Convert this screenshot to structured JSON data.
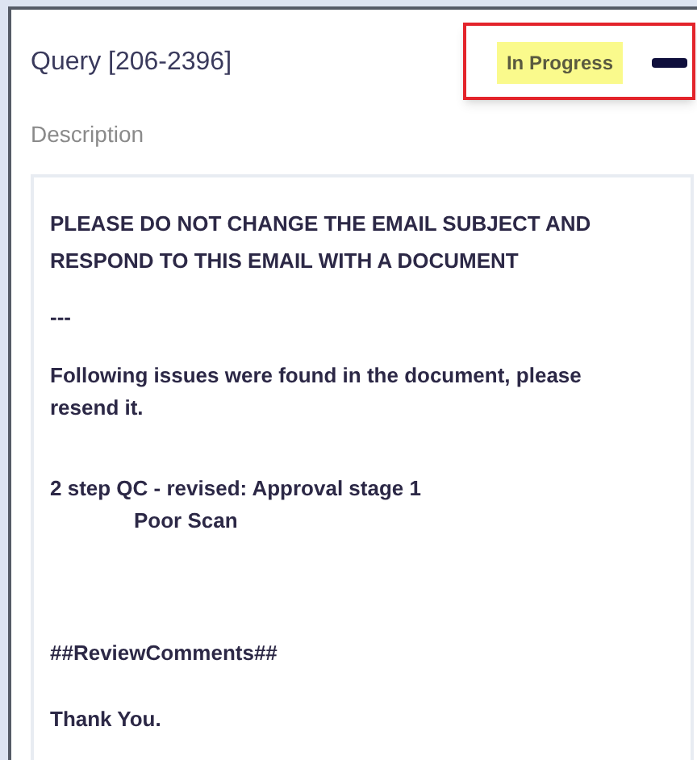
{
  "header": {
    "title": "Query [206-2396]",
    "status": "In Progress"
  },
  "description": {
    "label": "Description",
    "paragraphs": [
      {
        "kind": "paragraph",
        "text": "PLEASE DO NOT CHANGE THE EMAIL SUBJECT AND RESPOND TO THIS EMAIL WITH A DOCUMENT"
      },
      {
        "kind": "paragraph",
        "text": "---"
      },
      {
        "kind": "paragraph",
        "text": "Following issues were found in the document, please resend it."
      },
      {
        "kind": "paragraph",
        "text": "2 step QC - revised: Approval stage 1"
      },
      {
        "kind": "indented",
        "text": "Poor Scan"
      },
      {
        "kind": "paragraph",
        "text": "##ReviewComments##"
      },
      {
        "kind": "paragraph",
        "text": "Thank You."
      }
    ]
  }
}
